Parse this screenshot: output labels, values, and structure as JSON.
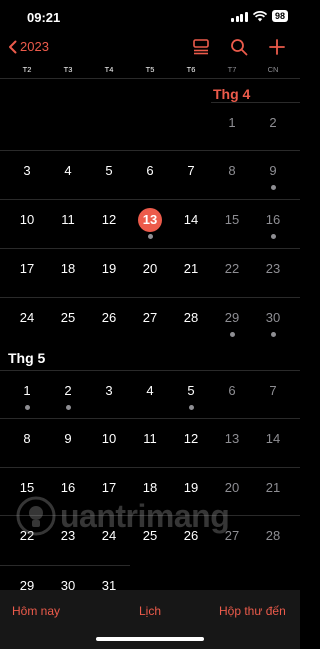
{
  "status": {
    "time": "09:21",
    "battery": "98"
  },
  "nav": {
    "back_label": "2023"
  },
  "weekdays": [
    "T2",
    "T3",
    "T4",
    "T5",
    "T6",
    "T7",
    "CN"
  ],
  "months": [
    {
      "label": "Thg 4",
      "weeks": [
        [
          null,
          null,
          null,
          null,
          null,
          "1",
          "2"
        ],
        [
          "3",
          "4",
          "5",
          "6",
          "7",
          "8",
          "9"
        ],
        [
          "10",
          "11",
          "12",
          "13",
          "14",
          "15",
          "16"
        ],
        [
          "17",
          "18",
          "19",
          "20",
          "21",
          "22",
          "23"
        ],
        [
          "24",
          "25",
          "26",
          "27",
          "28",
          "29",
          "30"
        ]
      ]
    },
    {
      "label": "Thg 5",
      "weeks": [
        [
          "1",
          "2",
          "3",
          "4",
          "5",
          "6",
          "7"
        ],
        [
          "8",
          "9",
          "10",
          "11",
          "12",
          "13",
          "14"
        ],
        [
          "15",
          "16",
          "17",
          "18",
          "19",
          "20",
          "21"
        ],
        [
          "22",
          "23",
          "24",
          "25",
          "26",
          "27",
          "28"
        ],
        [
          "29",
          "30",
          "31",
          null,
          null,
          null,
          null
        ]
      ]
    }
  ],
  "today": {
    "month": 0,
    "week": 2,
    "col": 3
  },
  "event_dots": [
    {
      "month": 0,
      "week": 1,
      "col": 6
    },
    {
      "month": 0,
      "week": 2,
      "col": 3
    },
    {
      "month": 0,
      "week": 2,
      "col": 6
    },
    {
      "month": 0,
      "week": 4,
      "col": 5
    },
    {
      "month": 0,
      "week": 4,
      "col": 6
    },
    {
      "month": 1,
      "week": 0,
      "col": 0
    },
    {
      "month": 1,
      "week": 0,
      "col": 1
    },
    {
      "month": 1,
      "week": 0,
      "col": 4
    }
  ],
  "toolbar": {
    "today": "Hôm nay",
    "calendars": "Lịch",
    "inbox": "Hộp thư đến"
  },
  "watermark_text": "uantrimang",
  "colors": {
    "accent": "#ec5b4b",
    "weekend": "#8e8e93",
    "background": "#000000",
    "bar": "#171717"
  }
}
